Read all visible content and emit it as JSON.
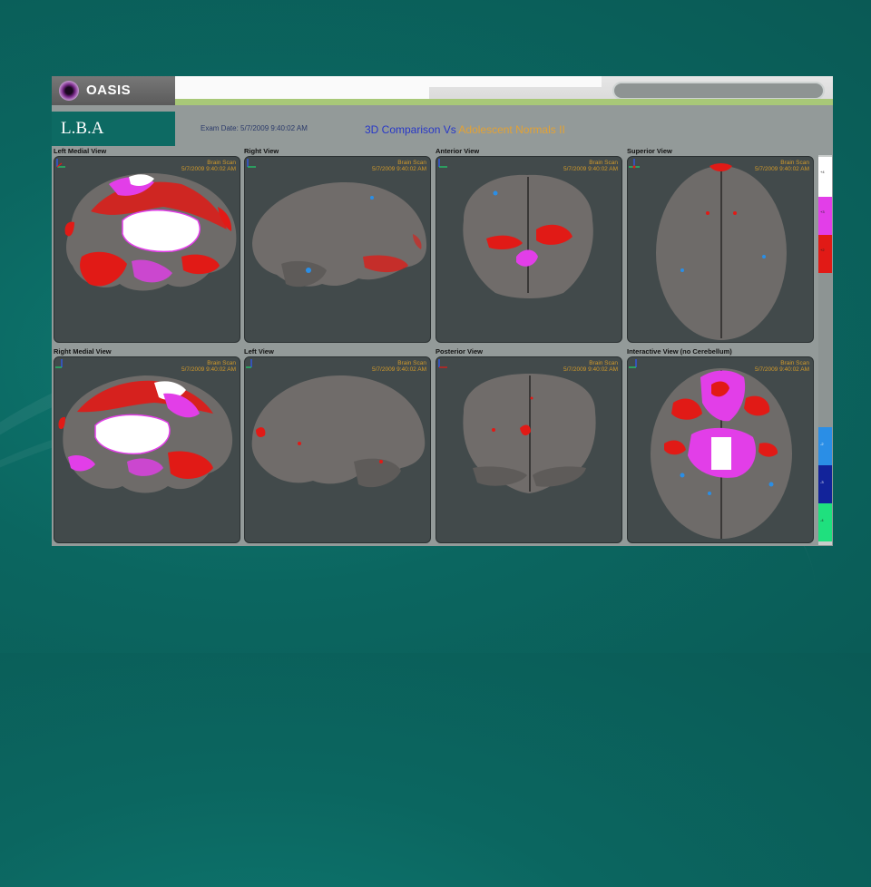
{
  "app": {
    "logo_text": "OASIS",
    "subject_label": "L.B.A"
  },
  "header": {
    "exam_date": "Exam Date: 5/7/2009 9:40:02 AM",
    "title_prefix": "3D Comparison Vs",
    "title_suffix": "Adolescent Normals II"
  },
  "views": [
    {
      "label": "Left Medial View",
      "stamp_1": "Brain Scan",
      "stamp_2": "5/7/2009 9:40:02 AM"
    },
    {
      "label": "Right View",
      "stamp_1": "Brain Scan",
      "stamp_2": "5/7/2009 9:40:02 AM"
    },
    {
      "label": "Anterior View",
      "stamp_1": "Brain Scan",
      "stamp_2": "5/7/2009 9:40:02 AM"
    },
    {
      "label": "Superior View",
      "stamp_1": "Brain Scan",
      "stamp_2": "5/7/2009 9:40:02 AM"
    },
    {
      "label": "Right Medial View",
      "stamp_1": "Brain Scan",
      "stamp_2": "5/7/2009 9:40:02 AM"
    },
    {
      "label": "Left View",
      "stamp_1": "Brain Scan",
      "stamp_2": "5/7/2009 9:40:02 AM"
    },
    {
      "label": "Posterior View",
      "stamp_1": "Brain Scan",
      "stamp_2": "5/7/2009 9:40:02 AM"
    },
    {
      "label": "Interactive View (no Cerebellum)",
      "stamp_1": "Brain Scan",
      "stamp_2": "5/7/2009 9:40:02 AM"
    }
  ],
  "legend": {
    "colors": {
      "white": "#ffffff",
      "magenta": "#e23ee8",
      "red": "#e11a16",
      "gray": "#8d9493",
      "light_blue": "#2a8ee6",
      "dark_blue": "#12239a",
      "green": "#1fe07e"
    },
    "labels": [
      "+4",
      "+3",
      "+2",
      "-2",
      "-3",
      "-4"
    ]
  },
  "colors": {
    "brain_gray": "#6e6b69",
    "panel_bg": "#424a4b",
    "title_blue": "#2737c8",
    "title_orange": "#e3a234",
    "accent_green": "#a8c878"
  }
}
